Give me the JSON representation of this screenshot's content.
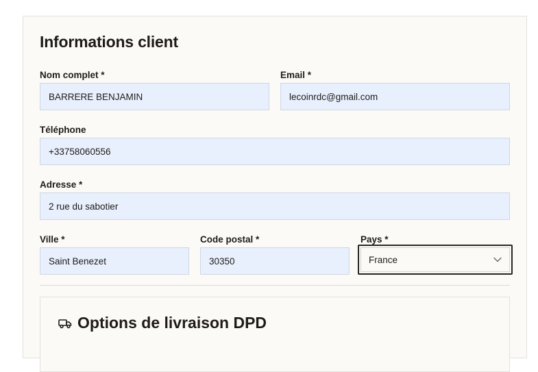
{
  "section": {
    "title": "Informations client"
  },
  "fields": {
    "nom": {
      "label": "Nom complet *",
      "value": "BARRERE BENJAMIN"
    },
    "email": {
      "label": "Email *",
      "value": "lecoinrdc@gmail.com"
    },
    "telephone": {
      "label": "Téléphone",
      "value": "+33758060556"
    },
    "adresse": {
      "label": "Adresse *",
      "value": "2 rue du sabotier"
    },
    "ville": {
      "label": "Ville *",
      "value": "Saint Benezet"
    },
    "code_postal": {
      "label": "Code postal *",
      "value": "30350"
    },
    "pays": {
      "label": "Pays *",
      "value": "France"
    }
  },
  "livraison": {
    "title": "Options de livraison DPD",
    "icon": "truck-icon"
  },
  "colors": {
    "autofill_bg": "#e8f0fe",
    "card_bg": "#fbfaf7",
    "focus_border": "#2a2420"
  }
}
